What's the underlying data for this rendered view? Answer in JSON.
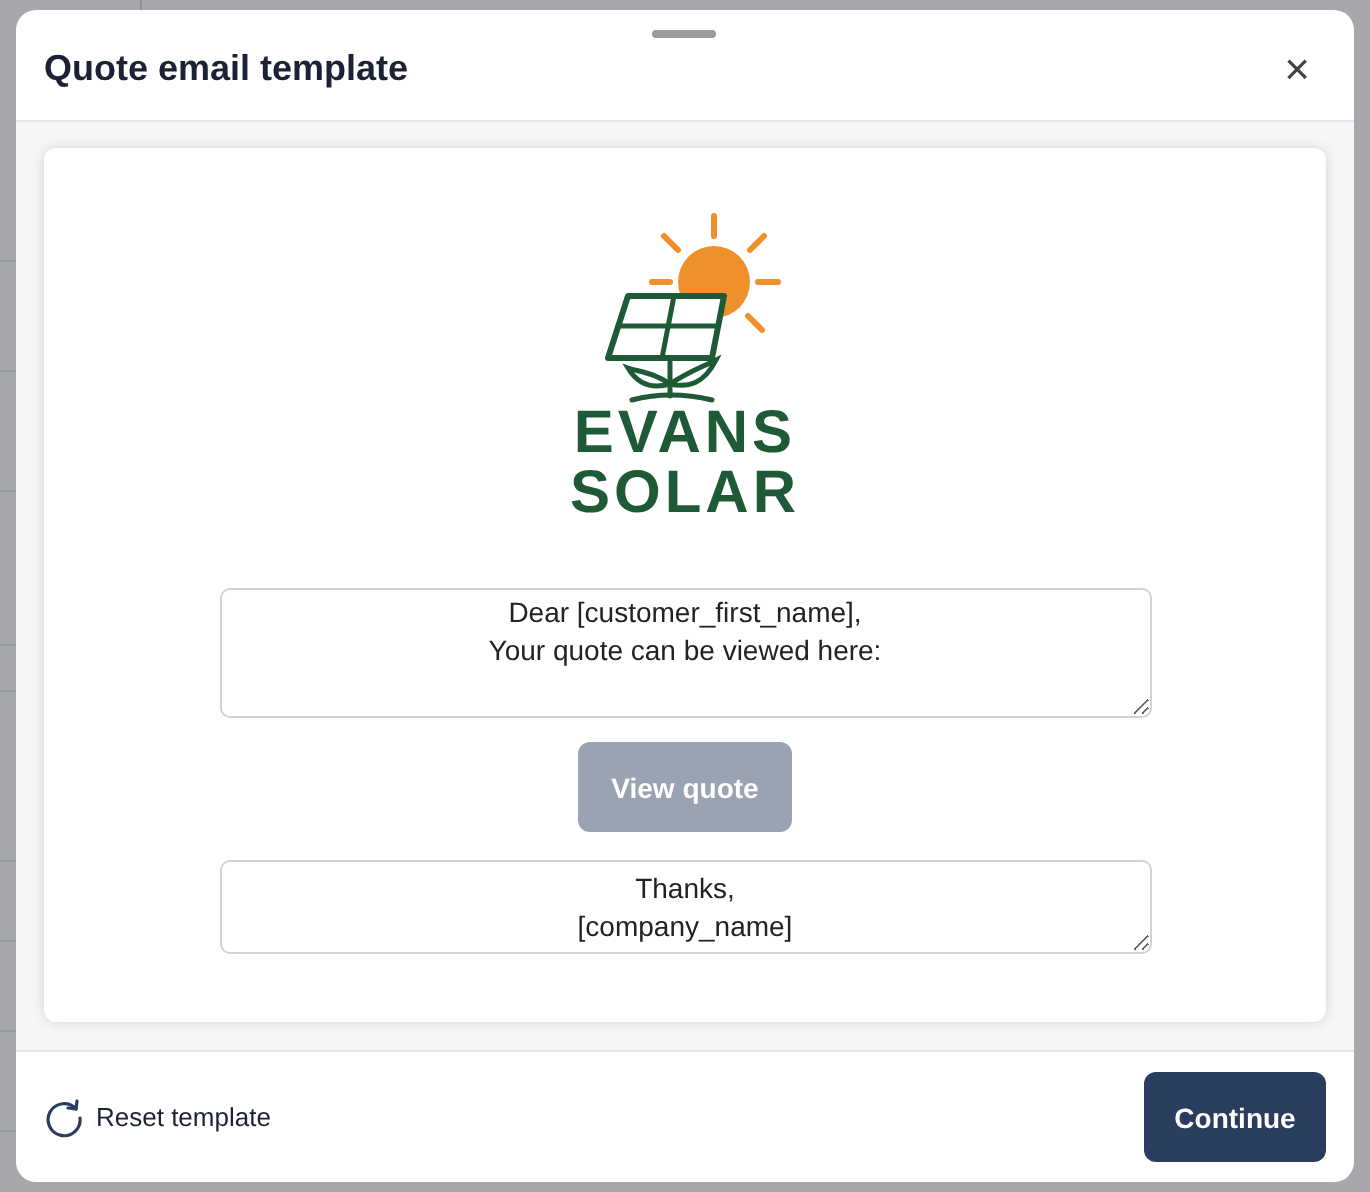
{
  "dialog": {
    "title": "Quote email template",
    "close": "×"
  },
  "logo": {
    "lines": [
      "EVANS",
      "SOLAR"
    ]
  },
  "greeting": {
    "value": "Dear [customer_first_name],\nYour quote can be viewed here:"
  },
  "view_button": {
    "label": "View quote",
    "disabled": true
  },
  "signoff": {
    "value": "Thanks,\n[company_name]"
  },
  "footer": {
    "reset": "Reset template",
    "continue": "Continue"
  }
}
